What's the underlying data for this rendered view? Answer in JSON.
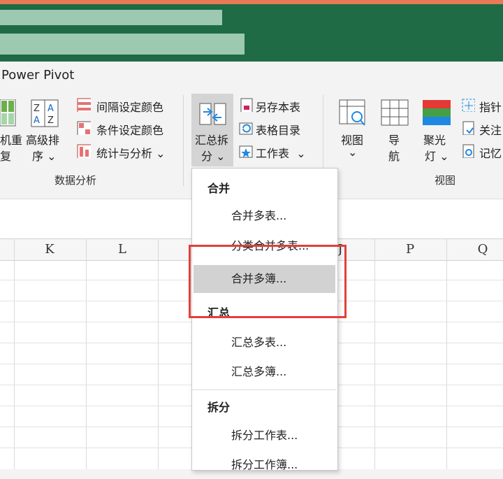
{
  "ribbon": {
    "tab_label": "Power Pivot",
    "group_data_analysis": {
      "label": "数据分析",
      "btn_partial_1a": "机重",
      "btn_partial_1b": "复",
      "btn_sort_1": "高级排",
      "btn_sort_2": "序",
      "item_interval_color": "间隔设定颜色",
      "item_condition_color": "条件设定颜色",
      "item_stats": "统计与分析"
    },
    "group_summary": {
      "btn_main_1": "汇总拆",
      "btn_main_2": "分",
      "item_save_table": "另存本表",
      "item_table_toc": "表格目录",
      "item_worksheet": "工作表"
    },
    "group_view": {
      "label": "视图",
      "btn_view": "视图",
      "btn_nav_1": "导",
      "btn_nav_2": "航",
      "btn_spotlight_1": "聚光",
      "btn_spotlight_2": "灯",
      "item_pointer": "指针",
      "item_follow": "关注",
      "item_memory": "记忆"
    },
    "colors": {
      "accent_green": "#1e6b46",
      "red_highlight": "#e0403a"
    }
  },
  "sheet": {
    "columns": [
      "K",
      "L",
      "P",
      "Q"
    ],
    "partial_column": "J"
  },
  "menu": {
    "section_merge": "合并",
    "merge_multi_table": "合并多表...",
    "classify_merge": "分类合并多表...",
    "merge_multi_book": "合并多簿...",
    "section_summary": "汇总",
    "summary_multi_table": "汇总多表...",
    "summary_multi_book": "汇总多簿...",
    "section_split": "拆分",
    "split_worksheet": "拆分工作表...",
    "split_workbook": "拆分工作簿..."
  }
}
